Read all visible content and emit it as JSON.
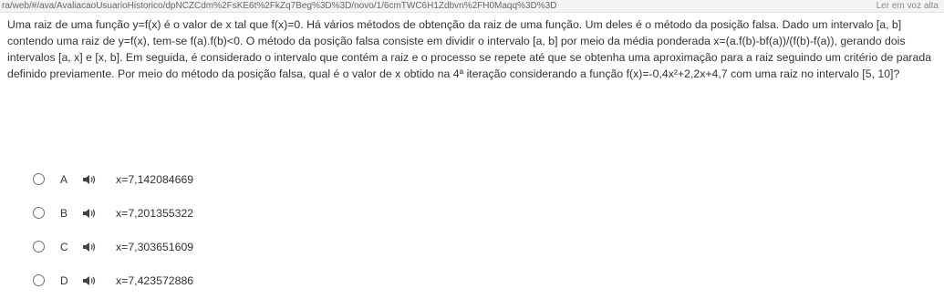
{
  "browser": {
    "url": "ra/web/#/ava/AvaliacaoUsuarioHistorico/dpNCZCdm%2FsKE6t%2FkZq7Beg%3D%3D/novo/1/6cmTWC6H1Zdbvn%2FH0Maqq%3D%3D",
    "read_aloud_label": "Ler em voz alta"
  },
  "question": {
    "text": "Uma raiz de uma função y=f(x) é o valor de x tal que f(x)=0. Há vários métodos de obtenção da raiz de uma função. Um deles é o método da posição falsa. Dado um intervalo [a, b] contendo uma raiz de y=f(x), tem-se f(a).f(b)<0. O método da posição falsa consiste em dividir o intervalo [a, b] por meio da média ponderada x=(a.f(b)-bf(a))/(f(b)-f(a)), gerando dois intervalos [a, x] e [x, b]. Em seguida, é considerado o intervalo que contém a raiz e o processo se repete até que se obtenha uma aproximação para a raiz seguindo um critério de parada definido previamente. Por meio do método da posição falsa, qual é o valor de x obtido na 4ª iteração considerando a função f(x)=-0,4x²+2,2x+4,7 com uma raiz no intervalo [5, 10]?"
  },
  "options": [
    {
      "letter": "A",
      "text": "x=7,142084669"
    },
    {
      "letter": "B",
      "text": "x=7,201355322"
    },
    {
      "letter": "C",
      "text": "x=7,303651609"
    },
    {
      "letter": "D",
      "text": "x=7,423572886"
    }
  ]
}
